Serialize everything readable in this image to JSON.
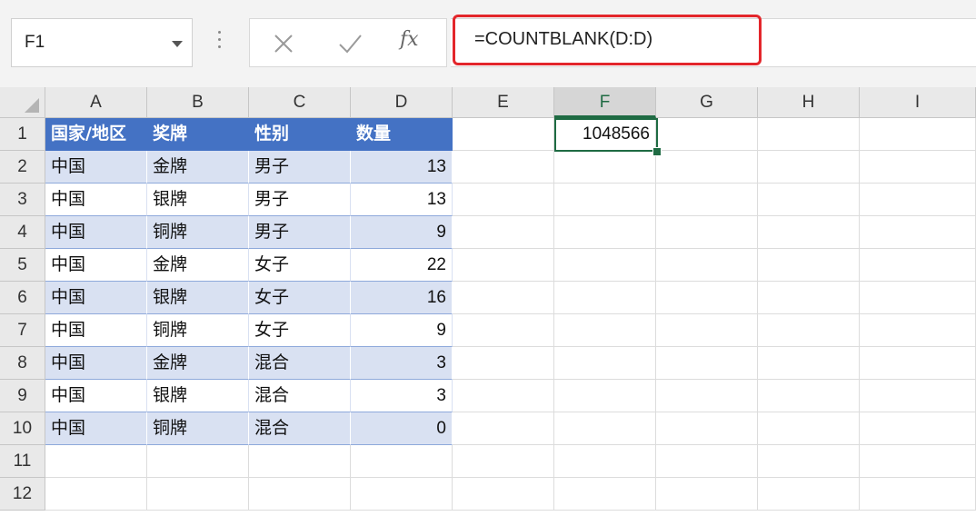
{
  "name_box": "F1",
  "formula": "=COUNTBLANK(D:D)",
  "columns": [
    "A",
    "B",
    "C",
    "D",
    "E",
    "F",
    "G",
    "H",
    "I"
  ],
  "rows": [
    "1",
    "2",
    "3",
    "4",
    "5",
    "6",
    "7",
    "8",
    "9",
    "10",
    "11",
    "12"
  ],
  "table_header": [
    "国家/地区",
    "奖牌",
    "性别",
    "数量"
  ],
  "table_rows": [
    [
      "中国",
      "金牌",
      "男子",
      "13"
    ],
    [
      "中国",
      "银牌",
      "男子",
      "13"
    ],
    [
      "中国",
      "铜牌",
      "男子",
      "9"
    ],
    [
      "中国",
      "金牌",
      "女子",
      "22"
    ],
    [
      "中国",
      "银牌",
      "女子",
      "16"
    ],
    [
      "中国",
      "铜牌",
      "女子",
      "9"
    ],
    [
      "中国",
      "金牌",
      "混合",
      "3"
    ],
    [
      "中国",
      "银牌",
      "混合",
      "3"
    ],
    [
      "中国",
      "铜牌",
      "混合",
      "0"
    ]
  ],
  "result_cell": "1048566",
  "colors": {
    "header_fill": "#4472c4",
    "band_fill": "#d9e1f2",
    "selection": "#1f6b43",
    "highlight": "#e3262b"
  },
  "icons": [
    "dropdown-arrow-icon",
    "cancel-icon",
    "enter-icon",
    "function-icon"
  ]
}
